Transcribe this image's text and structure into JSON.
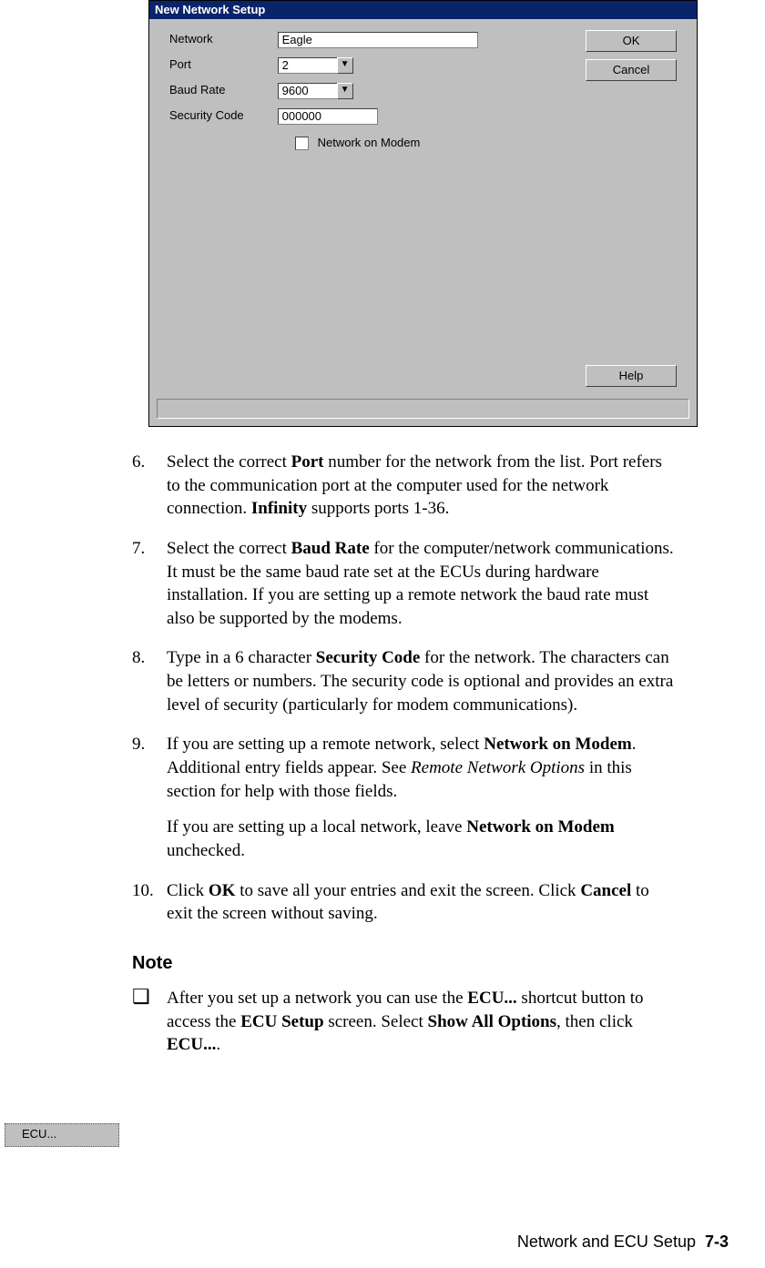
{
  "dialog": {
    "title": "New Network Setup",
    "fields": {
      "network_label": "Network",
      "network_value": "Eagle",
      "port_label": "Port",
      "port_value": "2",
      "baud_label": "Baud Rate",
      "baud_value": "9600",
      "security_label": "Security Code",
      "security_value": "000000",
      "modem_checkbox_label": "Network on Modem"
    },
    "buttons": {
      "ok": "OK",
      "cancel": "Cancel",
      "help": "Help"
    }
  },
  "steps": {
    "s6": {
      "num": "6.",
      "t1": "Select the correct ",
      "b1": "Port",
      "t2": " number for the network from the list. Port refers to the communication port at the computer used for the network connection. ",
      "b2": "Infinity",
      "t3": " supports ports 1-36."
    },
    "s7": {
      "num": "7.",
      "t1": "Select the correct ",
      "b1": "Baud Rate",
      "t2": " for the computer/network communications. It must be the same baud rate set at the ECUs during hardware installation. If you are setting up a remote network the baud rate must also be supported by the modems."
    },
    "s8": {
      "num": "8.",
      "t1": "Type in a 6 character ",
      "b1": "Security Code",
      "t2": " for the network. The characters can be letters or numbers. The security code is optional and provides an extra level of security (particularly for modem communications)."
    },
    "s9": {
      "num": "9.",
      "t1": "If you are setting up a remote network, select ",
      "b1": "Network on Modem",
      "t2": ". Additional entry fields appear. See ",
      "i1": "Remote Network Options",
      "t3": " in this section for help with those fields.",
      "p2a": "If you are setting up a local network, leave ",
      "p2b": "Network on Modem",
      "p2c": " unchecked."
    },
    "s10": {
      "num": "10.",
      "t1": "Click ",
      "b1": "OK",
      "t2": " to save all your entries and exit the screen. Click ",
      "b2": "Cancel",
      "t3": " to exit the screen without saving."
    }
  },
  "note": {
    "heading": "Note",
    "bullet": "❑",
    "t1": "After you set up a network you can use the ",
    "b1": "ECU...",
    "t2": " shortcut button to access the ",
    "b2": "ECU Setup",
    "t3": " screen. Select ",
    "b3": "Show All Options",
    "t4": ", then click ",
    "b4": "ECU...",
    "t5": "."
  },
  "ecu_button_graphic": "ECU...",
  "footer": {
    "text": "Network and ECU Setup",
    "page": "7-3"
  }
}
